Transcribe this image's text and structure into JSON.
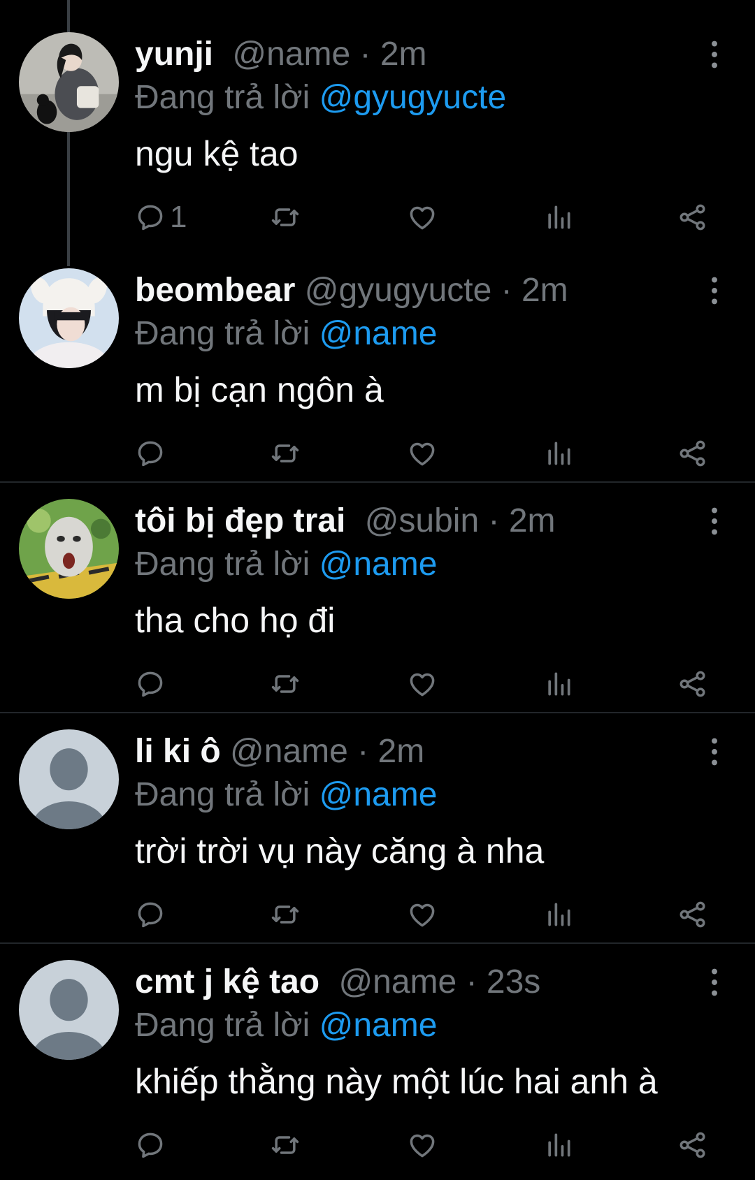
{
  "colors": {
    "background": "#000000",
    "text": "#f5f6f7",
    "secondary": "#71767b",
    "mention": "#1d9bf0",
    "divider": "#22262a",
    "thread_line": "#3a3f44"
  },
  "icons": [
    "reply-icon",
    "retweet-icon",
    "like-icon",
    "views-icon",
    "share-icon",
    "more-icon"
  ],
  "tweets": [
    {
      "display_name": "yunji",
      "handle": "@name",
      "separator": "·",
      "time": "2m",
      "reply_prefix": "Đang trả lời",
      "reply_to": "@gyugyucte",
      "text": "ngu kệ tao",
      "reply_count": "1",
      "avatar": "photo-girl-with-cat"
    },
    {
      "display_name": "beombear",
      "handle": "@gyugyucte",
      "separator": "·",
      "time": "2m",
      "reply_prefix": "Đang trả lời",
      "reply_to": "@name",
      "text": "m bị cạn ngôn à",
      "reply_count": "",
      "avatar": "photo-girl-bear-hat"
    },
    {
      "display_name": "tôi bị đẹp trai",
      "handle": "@subin",
      "separator": "·",
      "time": "2m",
      "reply_prefix": "Đang trả lời",
      "reply_to": "@name",
      "text": "tha cho họ đi",
      "reply_count": "",
      "avatar": "cartoon-face"
    },
    {
      "display_name": "li ki ô",
      "handle": "@name",
      "separator": "·",
      "time": "2m",
      "reply_prefix": "Đang trả lời",
      "reply_to": "@name",
      "text": "trời trời vụ này căng à nha",
      "reply_count": "",
      "avatar": "default-avatar"
    },
    {
      "display_name": "cmt j kệ tao",
      "handle": "@name",
      "separator": "·",
      "time": "23s",
      "reply_prefix": "Đang trả lời",
      "reply_to": "@name",
      "text": "khiếp thằng này một lúc hai anh à",
      "reply_count": "",
      "avatar": "default-avatar"
    }
  ]
}
